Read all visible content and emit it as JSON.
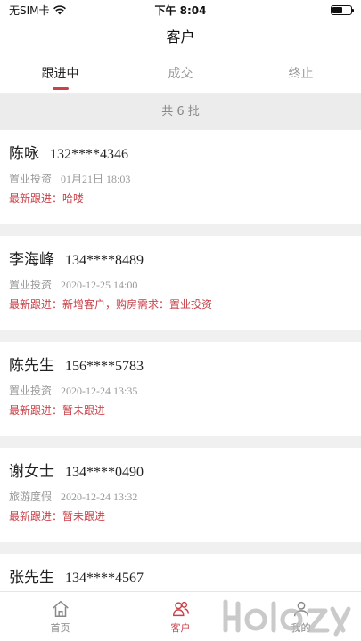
{
  "status_bar": {
    "carrier": "无SIM卡",
    "time": "下午 8:04"
  },
  "nav": {
    "title": "客户"
  },
  "tabs": [
    {
      "label": "跟进中",
      "active": true
    },
    {
      "label": "成交",
      "active": false
    },
    {
      "label": "终止",
      "active": false
    }
  ],
  "summary": {
    "text": "共 6 批"
  },
  "customers": [
    {
      "name": "陈咏",
      "phone": "132****4346",
      "category": "置业投资",
      "date": "01月21日 18:03",
      "followup": "最新跟进：哈喽"
    },
    {
      "name": "李海峰",
      "phone": "134****8489",
      "category": "置业投资",
      "date": "2020-12-25 14:00",
      "followup": "最新跟进：新增客户，购房需求：置业投资"
    },
    {
      "name": "陈先生",
      "phone": "156****5783",
      "category": "置业投资",
      "date": "2020-12-24 13:35",
      "followup": "最新跟进：暂未跟进"
    },
    {
      "name": "谢女士",
      "phone": "134****0490",
      "category": "旅游度假",
      "date": "2020-12-24 13:32",
      "followup": "最新跟进：暂未跟进"
    },
    {
      "name": "张先生",
      "phone": "134****4567",
      "category": "",
      "date": "",
      "followup": ""
    }
  ],
  "bottom_nav": [
    {
      "label": "首页",
      "icon": "home-icon",
      "active": false
    },
    {
      "label": "客户",
      "icon": "customers-icon",
      "active": true
    },
    {
      "label": "我的",
      "icon": "profile-icon",
      "active": false
    }
  ],
  "colors": {
    "accent": "#c9424a",
    "muted": "#999999",
    "background": "#f0f0f0"
  }
}
